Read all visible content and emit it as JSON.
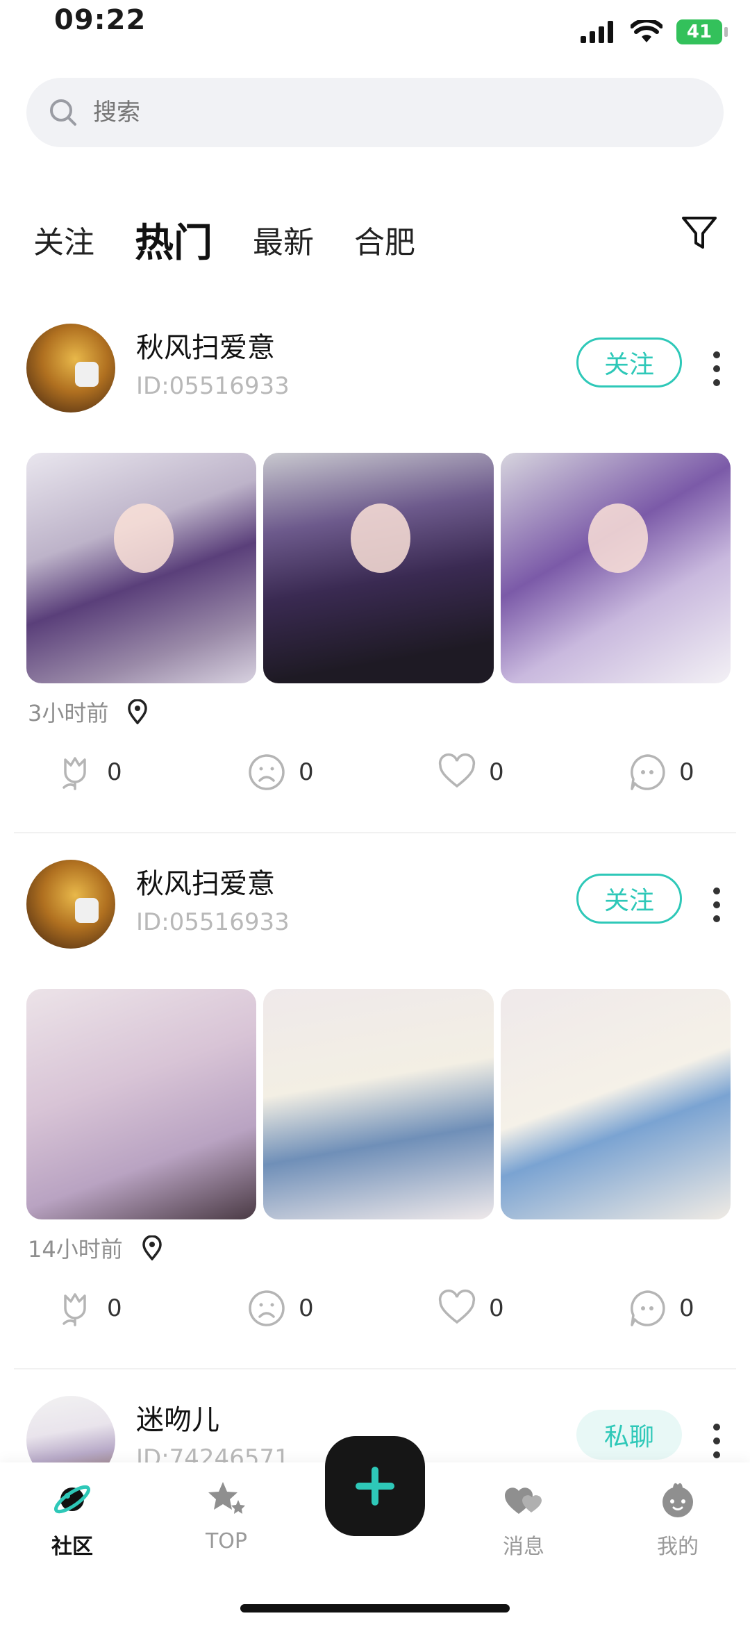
{
  "status_bar": {
    "time": "09:22",
    "battery": "41"
  },
  "search": {
    "placeholder": "搜索"
  },
  "tabs": [
    {
      "label": "关注"
    },
    {
      "label": "热门",
      "active": true
    },
    {
      "label": "最新"
    },
    {
      "label": "合肥"
    }
  ],
  "posts": [
    {
      "username": "秋风扫爱意",
      "user_id": "ID:05516933",
      "action_label": "关注",
      "time": "3小时前",
      "counts": {
        "flower": "0",
        "sad": "0",
        "like": "0",
        "comment": "0"
      }
    },
    {
      "username": "秋风扫爱意",
      "user_id": "ID:05516933",
      "action_label": "关注",
      "time": "14小时前",
      "counts": {
        "flower": "0",
        "sad": "0",
        "like": "0",
        "comment": "0"
      }
    },
    {
      "username": "迷吻儿",
      "user_id": "ID:74246571",
      "action_label": "私聊"
    }
  ],
  "bottom_nav": [
    {
      "label": "社区",
      "icon": "planet-icon",
      "active": true
    },
    {
      "label": "TOP",
      "icon": "stars-icon"
    },
    {
      "label": "",
      "icon": "plus-icon"
    },
    {
      "label": "消息",
      "icon": "hearts-icon"
    },
    {
      "label": "我的",
      "icon": "face-icon"
    }
  ],
  "colors": {
    "accent": "#2ec8b8",
    "fab": "#161616",
    "battery": "#33c15b"
  }
}
